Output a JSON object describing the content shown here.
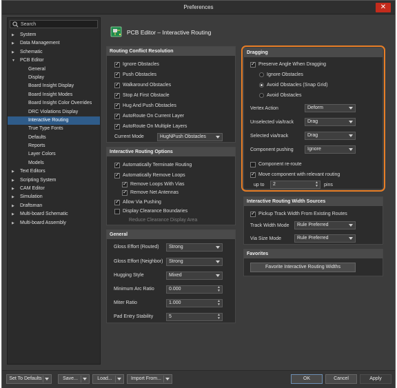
{
  "window": {
    "title": "Preferences"
  },
  "search": {
    "placeholder": "Search"
  },
  "tree": [
    {
      "label": "System",
      "level": 0,
      "arrow": "▶"
    },
    {
      "label": "Data Management",
      "level": 0,
      "arrow": "▶"
    },
    {
      "label": "Schematic",
      "level": 0,
      "arrow": "▶"
    },
    {
      "label": "PCB Editor",
      "level": 0,
      "arrow": "▼"
    },
    {
      "label": "General",
      "level": 1
    },
    {
      "label": "Display",
      "level": 1
    },
    {
      "label": "Board Insight Display",
      "level": 1
    },
    {
      "label": "Board Insight Modes",
      "level": 1
    },
    {
      "label": "Board Insight Color Overrides",
      "level": 1
    },
    {
      "label": "DRC Violations Display",
      "level": 1
    },
    {
      "label": "Interactive Routing",
      "level": 1,
      "selected": true
    },
    {
      "label": "True Type Fonts",
      "level": 1
    },
    {
      "label": "Defaults",
      "level": 1
    },
    {
      "label": "Reports",
      "level": 1
    },
    {
      "label": "Layer Colors",
      "level": 1
    },
    {
      "label": "Models",
      "level": 1
    },
    {
      "label": "Text Editors",
      "level": 0,
      "arrow": "▶"
    },
    {
      "label": "Scripting System",
      "level": 0,
      "arrow": "▶"
    },
    {
      "label": "CAM Editor",
      "level": 0,
      "arrow": "▶"
    },
    {
      "label": "Simulation",
      "level": 0,
      "arrow": "▶"
    },
    {
      "label": "Draftsman",
      "level": 0,
      "arrow": "▶"
    },
    {
      "label": "Multi-board Schematic",
      "level": 0,
      "arrow": "▶"
    },
    {
      "label": "Multi-board Assembly",
      "level": 0,
      "arrow": "▶"
    }
  ],
  "page": {
    "title": "PCB Editor – Interactive Routing"
  },
  "rcr": {
    "heading": "Routing Conflict Resolution",
    "ignore": "Ignore Obstacles",
    "push": "Push Obstacles",
    "walkaround": "Walkaround Obstacles",
    "stop": "Stop At First Obstacle",
    "hug": "Hug And Push Obstacles",
    "autoroute_current": "AutoRoute On Current Layer",
    "autoroute_multiple": "AutoRoute On Multiple Layers",
    "current_mode_label": "Current Mode",
    "current_mode_value": "HugNPush Obstacles"
  },
  "iro": {
    "heading": "Interactive Routing Options",
    "auto_terminate": "Automatically Terminate Routing",
    "auto_remove_loops": "Automatically Remove Loops",
    "remove_loops_vias": "Remove Loops With Vias",
    "remove_net_antennas": "Remove Net Antennas",
    "allow_via_pushing": "Allow Via Pushing",
    "display_clearance": "Display Clearance Boundaries",
    "reduce_clearance": "Reduce Clearance Display Area"
  },
  "general": {
    "heading": "General",
    "gloss_routed_label": "Gloss Effort (Routed)",
    "gloss_routed_value": "Strong",
    "gloss_neighbor_label": "Gloss Effort (Neighbor)",
    "gloss_neighbor_value": "Strong",
    "hugging_style_label": "Hugging Style",
    "hugging_style_value": "Mixed",
    "min_arc_label": "Minimum Arc Ratio",
    "min_arc_value": "0.000",
    "miter_label": "Miter Ratio",
    "miter_value": "1.000",
    "pad_entry_label": "Pad Entry Stability",
    "pad_entry_value": "5"
  },
  "dragging": {
    "heading": "Dragging",
    "preserve_angle": "Preserve Angle When Dragging",
    "ignore_obstacles": "Ignore Obstacles",
    "avoid_snap": "Avoid Obstacles (Snap Grid)",
    "avoid_obstacles": "Avoid Obstacles",
    "vertex_action_label": "Vertex Action",
    "vertex_action_value": "Deform",
    "unselected_via_label": "Unselected via/track",
    "unselected_via_value": "Drag",
    "selected_via_label": "Selected via/track",
    "selected_via_value": "Drag",
    "component_pushing_label": "Component pushing",
    "component_pushing_value": "Ignore",
    "component_reroute": "Component re-route",
    "move_component": "Move component with relevant routing",
    "up_to_label": "up to",
    "up_to_value": "2",
    "pins_label": "pins"
  },
  "irws": {
    "heading": "Interactive Routing Width Sources",
    "pickup": "Pickup Track Width From Existing Routes",
    "track_width_label": "Track Width Mode",
    "track_width_value": "Rule Preferred",
    "via_size_label": "Via Size Mode",
    "via_size_value": "Rule Preferred"
  },
  "favorites": {
    "heading": "Favorites",
    "button": "Favorite Interactive Routing Widths"
  },
  "bottom": {
    "set_defaults": "Set To Defaults",
    "save": "Save...",
    "load": "Load...",
    "import": "Import From...",
    "ok": "OK",
    "cancel": "Cancel",
    "apply": "Apply"
  },
  "colors": {
    "highlight": "#e87e26",
    "selection": "#2f5c8a",
    "close": "#c42b1c"
  }
}
